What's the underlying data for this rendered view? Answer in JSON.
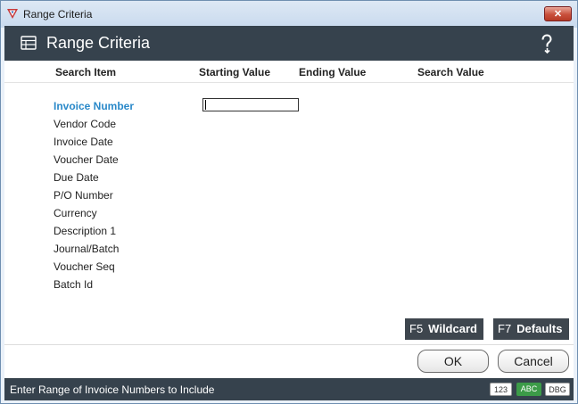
{
  "window": {
    "title": "Range Criteria",
    "close_glyph": "✕"
  },
  "header": {
    "title": "Range Criteria",
    "icon": "table-icon",
    "help_glyph": "?"
  },
  "columns": [
    "Search Item",
    "Starting Value",
    "Ending Value",
    "Search Value"
  ],
  "items": [
    "Invoice Number",
    "Vendor Code",
    "Invoice Date",
    "Voucher Date",
    "Due Date",
    "P/O Number",
    "Currency",
    "Description 1",
    "Journal/Batch",
    "Voucher Seq",
    "Batch Id"
  ],
  "start_input": {
    "value": ""
  },
  "fkeys": {
    "wildcard": {
      "key": "F5",
      "label": "Wildcard"
    },
    "defaults": {
      "key": "F7",
      "label": "Defaults"
    }
  },
  "buttons": {
    "ok": "OK",
    "cancel": "Cancel"
  },
  "status": {
    "text": "Enter Range of Invoice Numbers to Include",
    "badges": [
      "123",
      "ABC",
      "DBG"
    ]
  },
  "colors": {
    "accent": "#2a89c9",
    "header_bg": "#36424d",
    "abc_badge": "#3c9b48"
  }
}
